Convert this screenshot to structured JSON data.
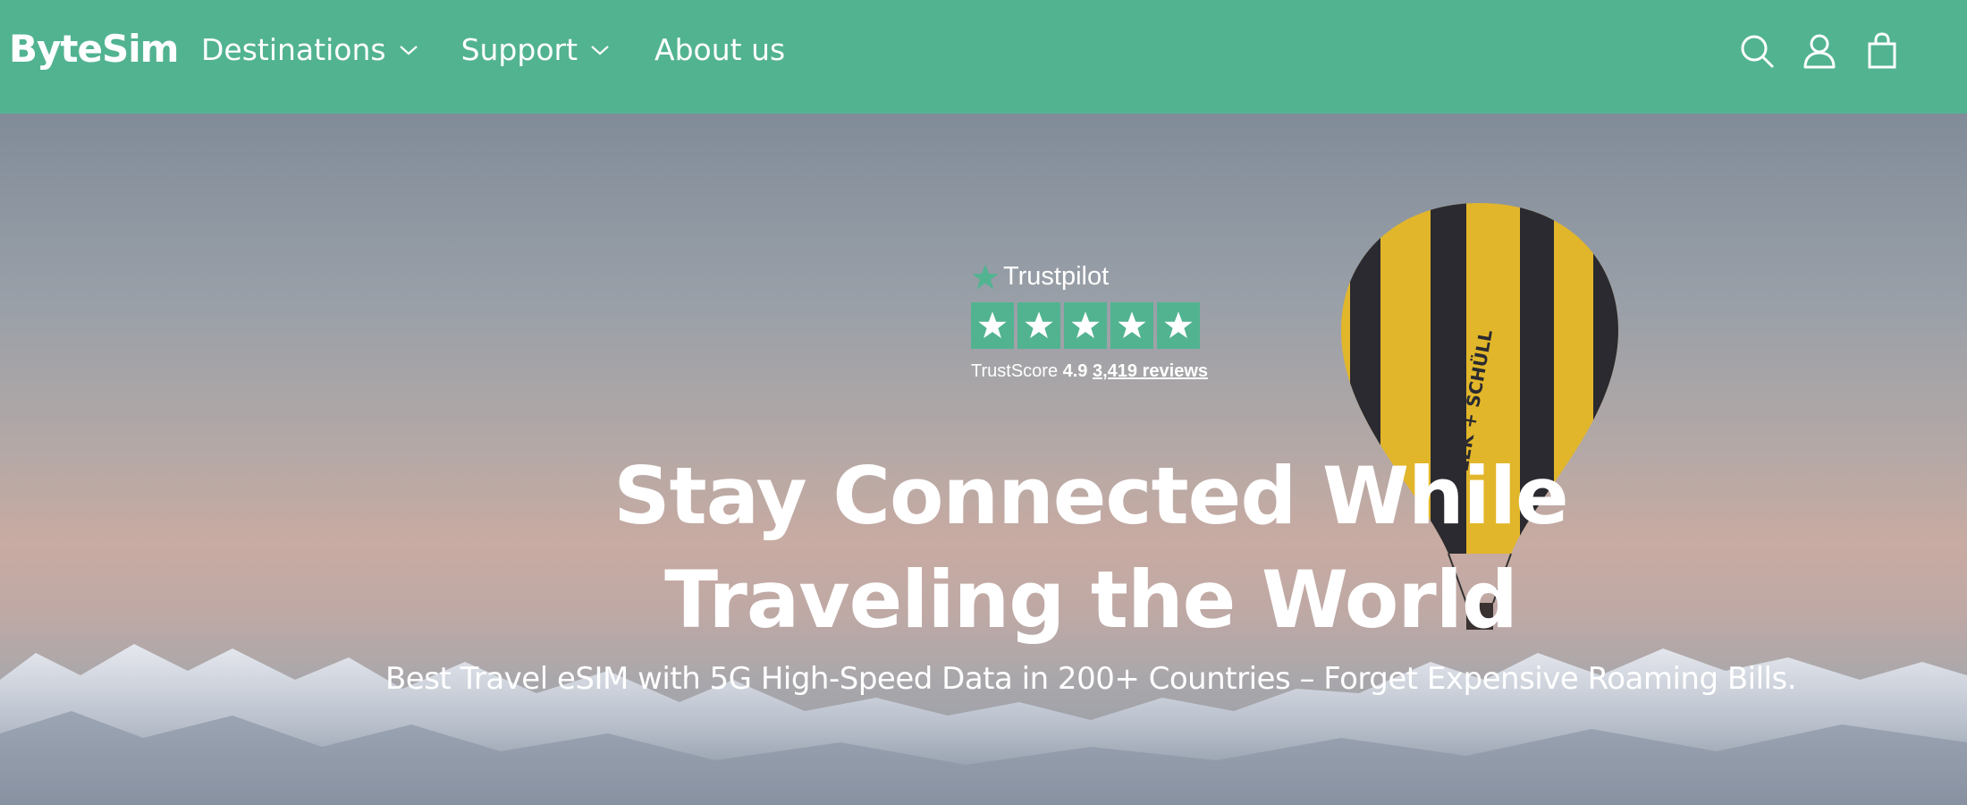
{
  "brand": {
    "logo": "ByteSim",
    "nav_color": "#52b391"
  },
  "nav": {
    "items": [
      {
        "label": "Destinations",
        "has_dropdown": true
      },
      {
        "label": "Support",
        "has_dropdown": true
      },
      {
        "label": "About us",
        "has_dropdown": false
      }
    ],
    "icons": [
      "search-icon",
      "account-icon",
      "cart-icon"
    ]
  },
  "trustpilot": {
    "brand": "Trustpilot",
    "stars": 5,
    "score_label": "TrustScore",
    "score": "4.9",
    "reviews": "3,419 reviews"
  },
  "hero": {
    "headline_line1": "Stay Connected While",
    "headline_line2": "Traveling the World",
    "subheadline": "Best Travel eSIM with 5G High-Speed Data in 200+ Countries – Forget Expensive Roaming Bills."
  }
}
